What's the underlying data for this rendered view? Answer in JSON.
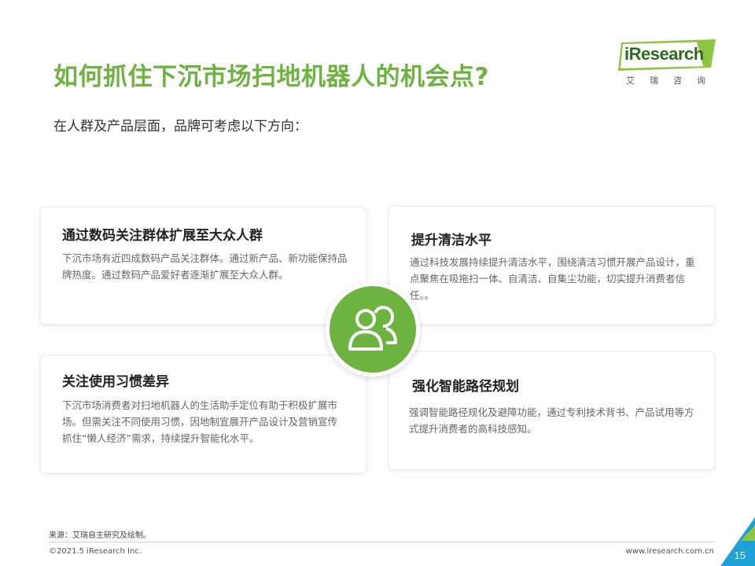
{
  "header": {
    "title": "如何抓住下沉市场扫地机器人的机会点?",
    "subtitle": "在人群及产品层面，品牌可考虑以下方向："
  },
  "logo": {
    "name": "iResearch",
    "sub": "艾瑞咨询"
  },
  "cards": [
    {
      "title": "通过数码关注群体扩展至大众人群",
      "body": [
        "下沉市场有近四成数码产品关注群体。通过新产品、新功能保持品牌热度。通过数码产品爱好者逐渐扩展至大众人群。"
      ]
    },
    {
      "title": "提升清洁水平",
      "body": [
        "通过科技发展持续提升清洁水平，围绕清洁习惯开展产品设计，重点聚焦在吸拖扫一体、自清洁、自集尘功能，切实提升消费者信任。。"
      ]
    },
    {
      "title": "关注使用习惯差异",
      "body": [
        "下沉市场消费者对扫地机器人的生活助手定位有助于积极扩展市场。但需关注不同使用习惯，因地制宜展开产品设计及营销宣传",
        "抓住“懒人经济”需求，持续提升智能化水平。"
      ]
    },
    {
      "title": "强化智能路径规划",
      "body": [
        "强调智能路径规化及避障功能，通过专利技术背书、产品试用等方式提升消费者的高科技感知。"
      ]
    }
  ],
  "center_icon": "users-icon",
  "footer": {
    "source": "来源：艾瑞自主研究及绘制。",
    "copyright": "©2021.5 iResearch Inc.",
    "website": "www.iresearch.com.cn",
    "page_number": "15"
  },
  "colors": {
    "accent": "#6db33f",
    "logo_dark": "#2f6b1f",
    "corner_blue": "#1ea0d8",
    "corner_green": "#8cc63f"
  }
}
